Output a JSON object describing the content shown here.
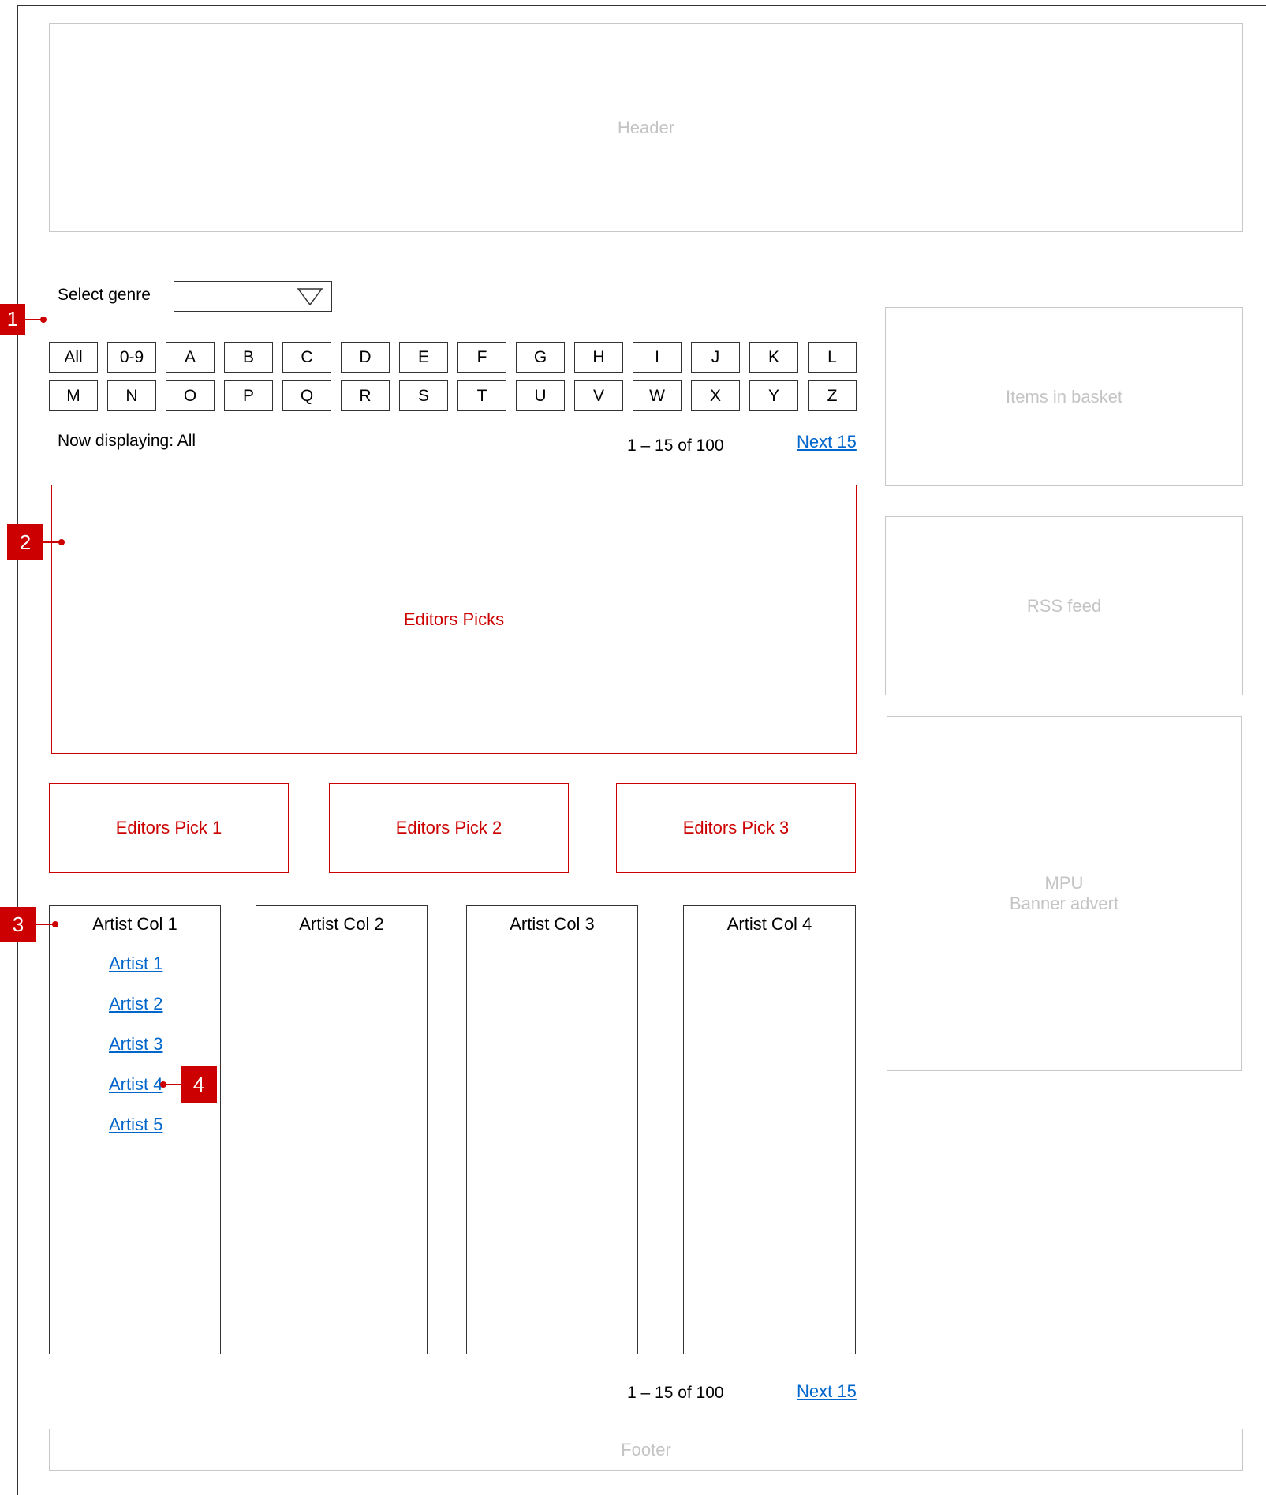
{
  "header": {
    "label": "Header"
  },
  "genre": {
    "label": "Select genre",
    "value": ""
  },
  "letters_row1": [
    "All",
    "0-9",
    "A",
    "B",
    "C",
    "D",
    "E",
    "F",
    "G",
    "H",
    "I",
    "J",
    "K",
    "L"
  ],
  "letters_row2": [
    "M",
    "N",
    "O",
    "P",
    "Q",
    "R",
    "S",
    "T",
    "U",
    "V",
    "W",
    "X",
    "Y",
    "Z"
  ],
  "status": {
    "now_displaying": "Now displaying: All"
  },
  "pagination_top": {
    "range": "1 – 15 of 100",
    "next": "Next 15"
  },
  "editors_picks": {
    "label": "Editors Picks",
    "picks": [
      "Editors Pick 1",
      "Editors Pick 2",
      "Editors Pick 3"
    ]
  },
  "artist_columns": [
    {
      "title": "Artist Col 1",
      "artists": [
        "Artist 1",
        "Artist 2",
        "Artist 3",
        "Artist 4",
        "Artist 5"
      ]
    },
    {
      "title": "Artist Col 2",
      "artists": []
    },
    {
      "title": "Artist Col 3",
      "artists": []
    },
    {
      "title": "Artist Col 4",
      "artists": []
    }
  ],
  "pagination_bottom": {
    "range": "1 – 15 of 100",
    "next": "Next 15"
  },
  "sidebar": {
    "basket": "Items in basket",
    "rss": "RSS feed",
    "mpu_line1": "MPU",
    "mpu_line2": "Banner advert"
  },
  "footer": {
    "label": "Footer"
  },
  "markers": [
    "1",
    "2",
    "3",
    "4"
  ],
  "colors": {
    "annotation": "#cc0000",
    "link": "#0066cc",
    "placeholder": "#c4c4c4"
  },
  "icons": {
    "dropdown": "triangle-down-icon"
  }
}
